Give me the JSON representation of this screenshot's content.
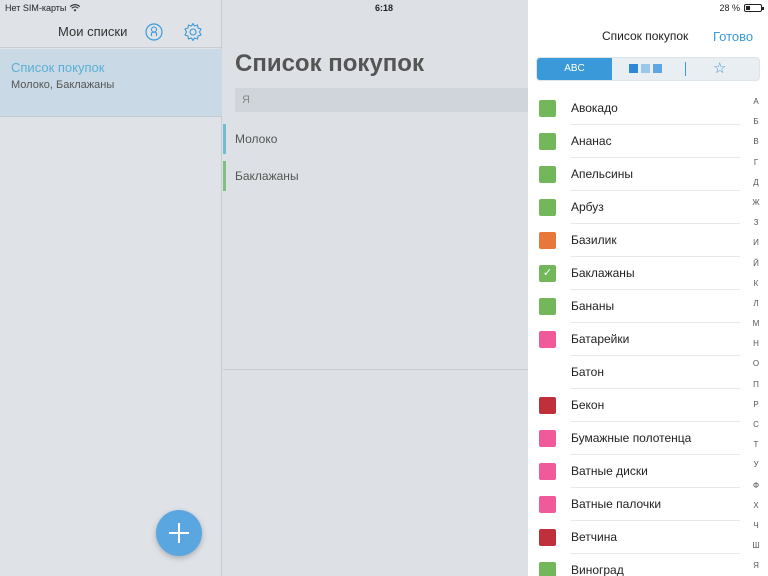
{
  "status_bar": {
    "carrier": "Нет SIM-карты",
    "time": "6:18",
    "battery_text": "28 %",
    "battery_level": 0.28
  },
  "sidebar": {
    "title": "Мои списки",
    "lists": [
      {
        "title": "Список покупок",
        "subtitle": "Молоко, Баклажаны"
      }
    ]
  },
  "main": {
    "title": "Список покупок",
    "input_value": "Я",
    "rows": [
      {
        "label": "Молоко",
        "color": "#6bbfd0"
      },
      {
        "label": "Баклажаны",
        "color": "#7fbf7f"
      }
    ]
  },
  "panel": {
    "title": "Список покупок",
    "done": "Готово",
    "segments": {
      "abc": "ABC"
    },
    "items": [
      {
        "label": "Авокадо",
        "color": "#72b85a",
        "checked": false
      },
      {
        "label": "Ананас",
        "color": "#72b85a",
        "checked": false
      },
      {
        "label": "Апельсины",
        "color": "#72b85a",
        "checked": false
      },
      {
        "label": "Арбуз",
        "color": "#72b85a",
        "checked": false
      },
      {
        "label": "Базилик",
        "color": "#e8773a",
        "checked": false
      },
      {
        "label": "Баклажаны",
        "color": "#72b85a",
        "checked": true
      },
      {
        "label": "Бананы",
        "color": "#72b85a",
        "checked": false
      },
      {
        "label": "Батарейки",
        "color": "#f05a9a",
        "checked": false
      },
      {
        "label": "Батон",
        "color": "",
        "checked": false
      },
      {
        "label": "Бекон",
        "color": "#c0303a",
        "checked": false
      },
      {
        "label": "Бумажные полотенца",
        "color": "#f05a9a",
        "checked": false
      },
      {
        "label": "Ватные диски",
        "color": "#f05a9a",
        "checked": false
      },
      {
        "label": "Ватные палочки",
        "color": "#f05a9a",
        "checked": false
      },
      {
        "label": "Ветчина",
        "color": "#c0303a",
        "checked": false
      },
      {
        "label": "Виноград",
        "color": "#72b85a",
        "checked": false
      }
    ],
    "alphabet": [
      "А",
      "Б",
      "В",
      "Г",
      "Д",
      "Ж",
      "З",
      "И",
      "Й",
      "К",
      "Л",
      "М",
      "Н",
      "О",
      "П",
      "Р",
      "С",
      "Т",
      "У",
      "Ф",
      "Х",
      "Ч",
      "Ш",
      "Я"
    ]
  }
}
